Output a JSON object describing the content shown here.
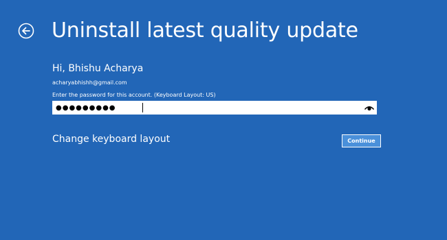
{
  "header": {
    "title": "Uninstall latest quality update",
    "back_icon": "back-arrow-icon"
  },
  "account": {
    "greeting": "Hi, Bhishu Acharya",
    "email": "acharyabhishh@gmail.com"
  },
  "password": {
    "prompt": "Enter the password for this account. (Keyboard Layout: US)",
    "masked_value": "●●●●●●●●●",
    "reveal_icon": "eye-icon"
  },
  "actions": {
    "change_keyboard_label": "Change keyboard layout",
    "continue_label": "Continue"
  },
  "colors": {
    "background": "#2266b7",
    "text": "#ffffff",
    "button_fill": "#4a90da",
    "field_background": "#ffffff"
  }
}
